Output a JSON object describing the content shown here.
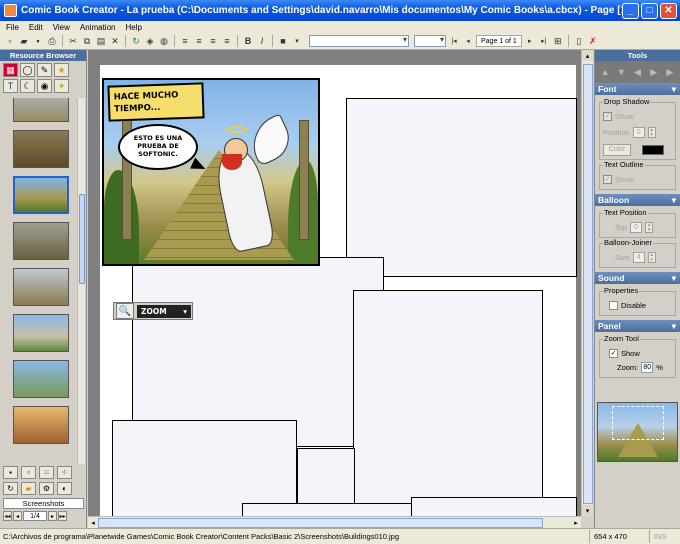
{
  "window": {
    "title": "Comic Book Creator - La prueba (C:\\Documents and Settings\\david.navarro\\Mis documentos\\My Comic Books\\a.cbcx) - Page [1]"
  },
  "menu": [
    "File",
    "Edit",
    "View",
    "Animation",
    "Help"
  ],
  "toolbar": {
    "page_label": "Page 1 of 1"
  },
  "resource_browser": {
    "title": "Resource Browser",
    "category": "Screenshots",
    "page": "1/4"
  },
  "comic": {
    "caption": "HACE MUCHO TIEMPO...",
    "balloon": "ESTO ES UNA PRUEBA DE SOFTONIC."
  },
  "zoom_tool": {
    "label": "ZOOM"
  },
  "tools": {
    "title": "Tools",
    "font": {
      "header": "Font",
      "drop_shadow_group": "Drop Shadow",
      "show_label": "Show",
      "position_label": "Position",
      "position_value": "0",
      "color_button": "Color",
      "shadow_color": "#000000",
      "text_outline_group": "Text Outline",
      "outline_show_label": "Show"
    },
    "balloon": {
      "header": "Balloon",
      "text_position_group": "Text Position",
      "top_label": "Top",
      "top_value": "0",
      "balloon_joiner_group": "Balloon-Joiner",
      "size_label": "Size",
      "size_value": "4"
    },
    "sound": {
      "header": "Sound",
      "properties_group": "Properties",
      "disable_label": "Disable"
    },
    "panel": {
      "header": "Panel",
      "zoom_tool_group": "Zoom Tool",
      "show_label": "Show",
      "zoom_label": "Zoom:",
      "zoom_value": "80",
      "zoom_unit": "%"
    }
  },
  "status": {
    "path": "C:\\Archivos de programa\\Planetwide Games\\Comic Book Creator\\Content Packs\\Basic 2\\Screenshots\\Buildings010.jpg",
    "dimensions": "654 x 470",
    "mode": "INS"
  },
  "colors": {
    "titlebar": "#0a58e0",
    "panel_header": "#4b6e9c",
    "caption_box": "#f5de6a"
  }
}
